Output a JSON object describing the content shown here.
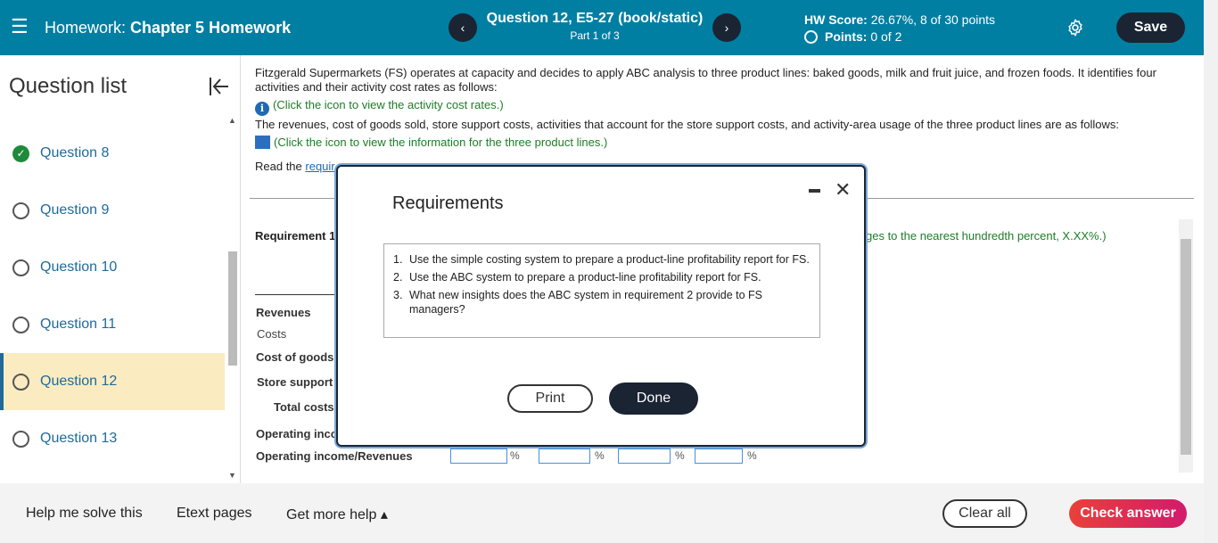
{
  "header": {
    "hw_label": "Homework:",
    "hw_name": "Chapter 5 Homework",
    "prev": "‹",
    "next": "›",
    "question_title": "Question 12, E5-27 (book/static)",
    "part": "Part 1 of 3",
    "hw_score_label": "HW Score:",
    "hw_score_value": "26.67%, 8 of 30 points",
    "points_label": "Points:",
    "points_value": "0 of 2",
    "save_label": "Save"
  },
  "sidebar": {
    "title": "Question list",
    "items": [
      {
        "label": "Question 8",
        "status": "complete"
      },
      {
        "label": "Question 9",
        "status": "open"
      },
      {
        "label": "Question 10",
        "status": "open"
      },
      {
        "label": "Question 11",
        "status": "open"
      },
      {
        "label": "Question 12",
        "status": "active"
      },
      {
        "label": "Question 13",
        "status": "open"
      }
    ]
  },
  "content": {
    "intro": "Fitzgerald Supermarkets (FS) operates at capacity and decides to apply ABC analysis to three product lines: baked goods, milk and fruit juice, and frozen foods. It identifies four activities and their activity cost rates as follows:",
    "activity_link": "(Click the icon to view the activity cost rates.)",
    "revenues_text": "The revenues, cost of goods sold, store support costs, activities that account for the store support costs, and activity-area usage of the three product lines are as follows:",
    "product_link": "(Click the icon to view the information for the three product lines.)",
    "read_the": "Read the",
    "req_link": "requir",
    "requirement_label": "Requirement 1",
    "hint_tail": "ges to the nearest hundredth percent, X.XX%.)",
    "rows": {
      "revenues": "Revenues",
      "costs": "Costs",
      "cogs": "Cost of goods",
      "store_support": "Store support",
      "total_costs": "Total costs",
      "operating_income": "Operating inco",
      "oi_revenues": "Operating income/Revenues"
    },
    "pct": "%"
  },
  "modal": {
    "title": "Requirements",
    "items": [
      {
        "num": "1.",
        "text": "Use the simple costing system to prepare a product-line profitability report for FS."
      },
      {
        "num": "2.",
        "text": "Use the ABC system to prepare a product-line profitability report for FS."
      },
      {
        "num": "3.",
        "text": "What new insights does the ABC system in requirement 2 provide to FS managers?"
      }
    ],
    "print_label": "Print",
    "done_label": "Done"
  },
  "footer": {
    "help_solve": "Help me solve this",
    "etext": "Etext pages",
    "more_help": "Get more help ▴",
    "clear_all": "Clear all",
    "check_answer": "Check answer"
  },
  "colors": {
    "header_bg": "#007fa3",
    "dark_button": "#1a2433",
    "active_question_bg": "#faecc0",
    "link_green": "#1d7d27",
    "check_answer": "#e8413a"
  }
}
